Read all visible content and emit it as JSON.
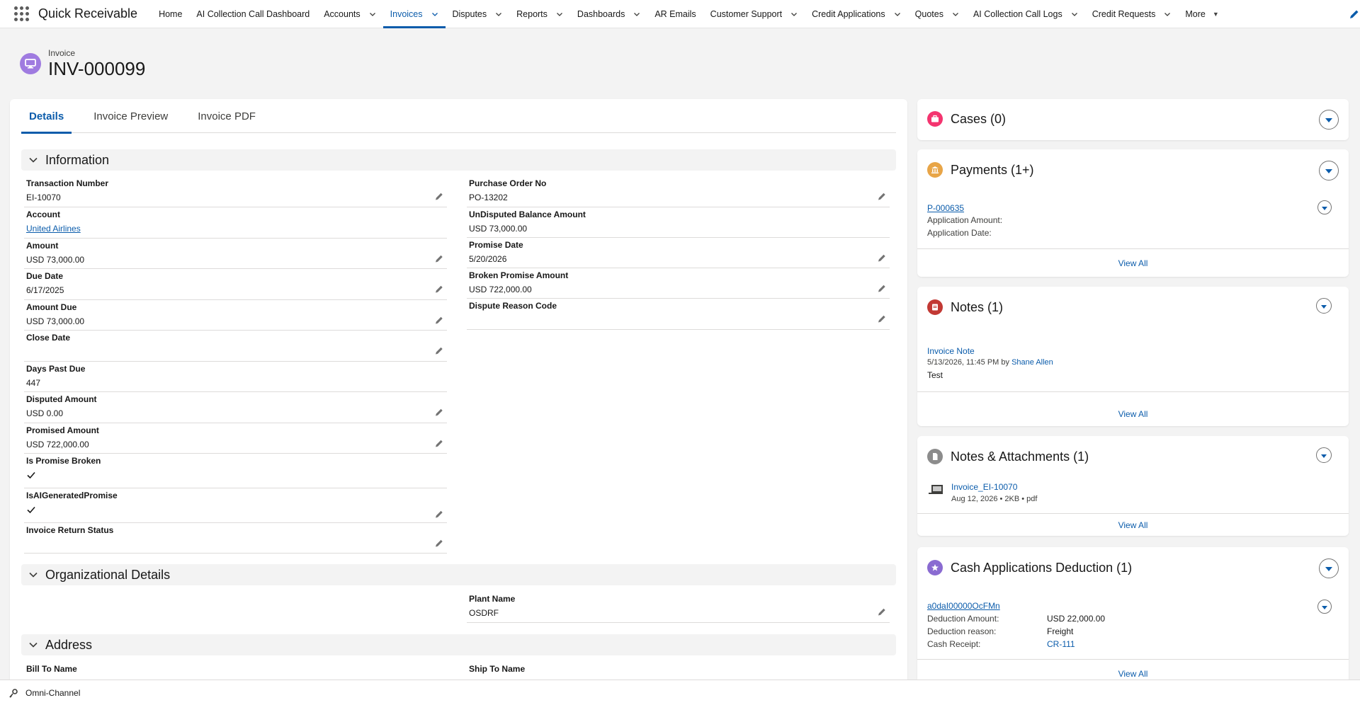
{
  "app": {
    "name": "Quick Receivable"
  },
  "nav": {
    "items": [
      {
        "label": "Home",
        "chevron": false,
        "active": false
      },
      {
        "label": "AI Collection Call Dashboard",
        "chevron": false,
        "active": false
      },
      {
        "label": "Accounts",
        "chevron": true,
        "active": false
      },
      {
        "label": "Invoices",
        "chevron": true,
        "active": true
      },
      {
        "label": "Disputes",
        "chevron": true,
        "active": false
      },
      {
        "label": "Reports",
        "chevron": true,
        "active": false
      },
      {
        "label": "Dashboards",
        "chevron": true,
        "active": false
      },
      {
        "label": "AR Emails",
        "chevron": false,
        "active": false
      },
      {
        "label": "Customer Support",
        "chevron": true,
        "active": false
      },
      {
        "label": "Credit Applications",
        "chevron": true,
        "active": false
      },
      {
        "label": "Quotes",
        "chevron": true,
        "active": false
      },
      {
        "label": "AI Collection Call Logs",
        "chevron": true,
        "active": false
      },
      {
        "label": "Credit Requests",
        "chevron": true,
        "active": false
      }
    ],
    "more_label": "More"
  },
  "record": {
    "type": "Invoice",
    "title": "INV-000099"
  },
  "tabs": [
    "Details",
    "Invoice Preview",
    "Invoice PDF"
  ],
  "sections": {
    "information": "Information",
    "organizational": "Organizational Details",
    "address": "Address"
  },
  "fields_left": [
    {
      "label": "Transaction Number",
      "value": "EI-10070",
      "editable": true
    },
    {
      "label": "Account",
      "value": "United Airlines",
      "link": true,
      "editable": false
    },
    {
      "label": "Amount",
      "value": "USD 73,000.00",
      "editable": true
    },
    {
      "label": "Due Date",
      "value": "6/17/2025",
      "editable": true
    },
    {
      "label": "Amount Due",
      "value": "USD 73,000.00",
      "editable": true
    },
    {
      "label": "Close Date",
      "value": "",
      "editable": true
    },
    {
      "label": "Days Past Due",
      "value": "447",
      "editable": false
    },
    {
      "label": "Disputed Amount",
      "value": "USD 0.00",
      "editable": true
    },
    {
      "label": "Promised Amount",
      "value": "USD 722,000.00",
      "editable": true
    },
    {
      "label": "Is Promise Broken",
      "value": "",
      "checked": true,
      "editable": false
    },
    {
      "label": "IsAIGeneratedPromise",
      "value": "",
      "checked": true,
      "editable": true
    },
    {
      "label": "Invoice Return Status",
      "value": "",
      "editable": true
    }
  ],
  "fields_right": [
    {
      "label": "Purchase Order No",
      "value": "PO-13202",
      "editable": true
    },
    {
      "label": "UnDisputed Balance Amount",
      "value": "USD 73,000.00",
      "editable": false
    },
    {
      "label": "Promise Date",
      "value": "5/20/2026",
      "editable": true
    },
    {
      "label": "Broken Promise Amount",
      "value": "USD 722,000.00",
      "editable": true
    },
    {
      "label": "Dispute Reason Code",
      "value": "",
      "editable": true
    }
  ],
  "org_fields": [
    {
      "label": "Plant Name",
      "value": "OSDRF",
      "editable": true
    }
  ],
  "address_fields": [
    {
      "label": "Bill To Name",
      "value": ""
    },
    {
      "label": "Ship To Name",
      "value": ""
    }
  ],
  "related": {
    "cases": {
      "title": "Cases (0)",
      "color": "#f4346f"
    },
    "payments": {
      "title": "Payments (1+)",
      "color": "#e8a547",
      "record": "P-000635",
      "lines": [
        "Application Amount:",
        "Application Date:"
      ],
      "view_all": "View All"
    },
    "notes": {
      "title": "Notes (1)",
      "color": "#c23934",
      "note_title": "Invoice Note",
      "meta_prefix": "5/13/2026, 11:45 PM by",
      "author": "Shane Allen",
      "body": "Test",
      "view_all": "View All"
    },
    "attachments": {
      "title": "Notes & Attachments (1)",
      "color": "#8c8c8c",
      "file_name": "Invoice_EI-10070",
      "file_meta": "Aug 12, 2026 • 2KB • pdf",
      "view_all": "View All"
    },
    "deductions": {
      "title": "Cash Applications Deduction (1)",
      "color": "#8a6bd1",
      "record": "a0daI00000OcFMn",
      "rows": [
        {
          "label": "Deduction Amount:",
          "value": "USD 22,000.00",
          "link": false
        },
        {
          "label": "Deduction reason:",
          "value": "Freight",
          "link": false
        },
        {
          "label": "Cash Receipt:",
          "value": "CR-111",
          "link": true
        }
      ],
      "view_all": "View All"
    }
  },
  "utility": {
    "omni_label": "Omni-Channel"
  }
}
